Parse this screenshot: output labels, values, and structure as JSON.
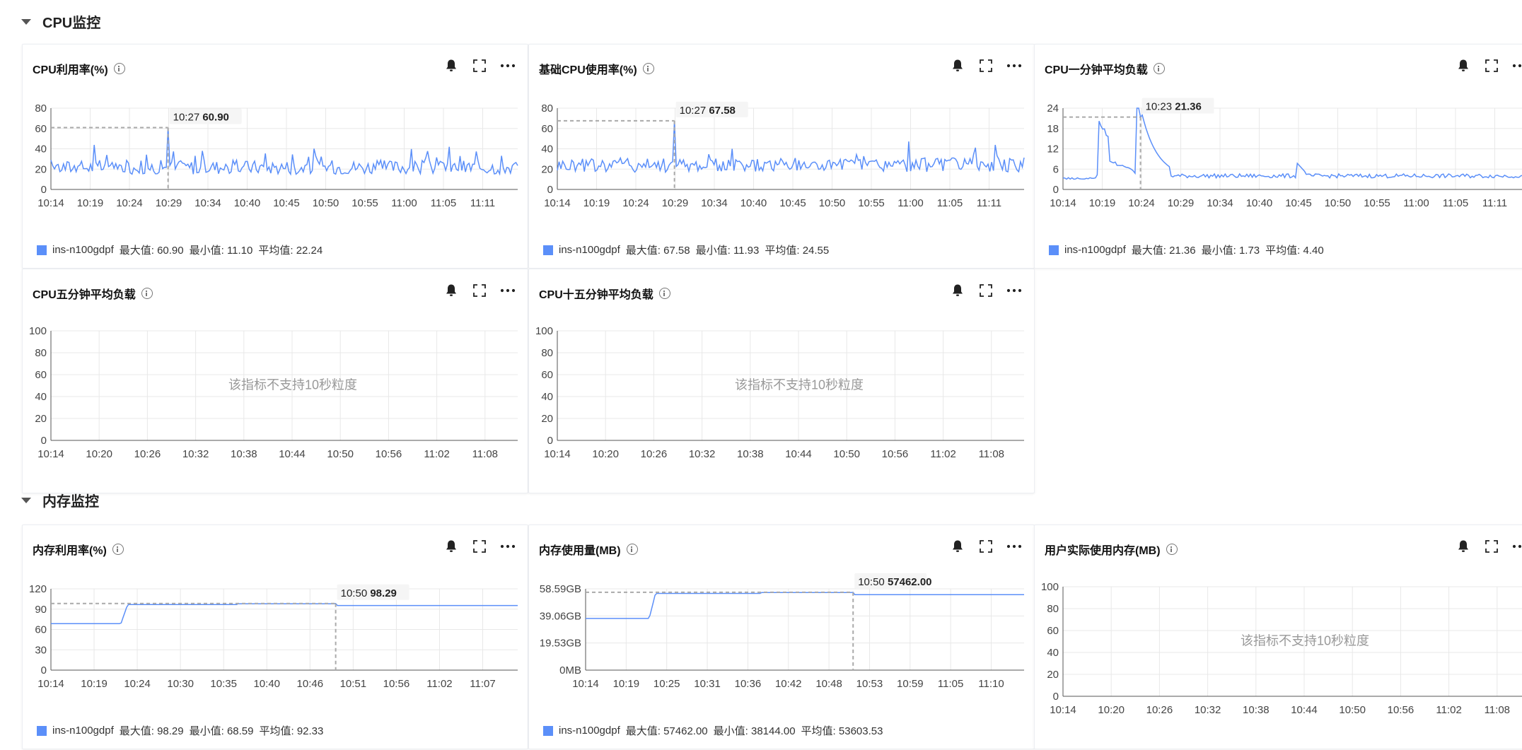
{
  "sections": {
    "cpu": "CPU监控",
    "mem": "内存监控"
  },
  "cards": [
    {
      "title": "CPU利用率(%)",
      "yticks": [
        "80",
        "60",
        "40",
        "20",
        "0"
      ],
      "ymax": 80,
      "xticks": [
        "10:14",
        "10:19",
        "10:24",
        "10:29",
        "10:34",
        "10:40",
        "10:45",
        "10:50",
        "10:55",
        "11:00",
        "11:05",
        "11:11"
      ],
      "tooltip": {
        "time": "10:27",
        "value": "60.90"
      },
      "legend": {
        "name": "ins-n100gdpf",
        "max": "最大值: 60.90",
        "min": "最小值: 11.10",
        "avg": "平均值: 22.24"
      },
      "series_shape": "spiky",
      "peak_fraction": 0.25,
      "peak_value": 60.9,
      "base_value": 22
    },
    {
      "title": "基础CPU使用率(%)",
      "yticks": [
        "80",
        "60",
        "40",
        "20",
        "0"
      ],
      "ymax": 80,
      "xticks": [
        "10:14",
        "10:19",
        "10:24",
        "10:29",
        "10:34",
        "10:40",
        "10:45",
        "10:50",
        "10:55",
        "11:00",
        "11:05",
        "11:11"
      ],
      "tooltip": {
        "time": "10:27",
        "value": "67.58"
      },
      "legend": {
        "name": "ins-n100gdpf",
        "max": "最大值: 67.58",
        "min": "最小值: 11.93",
        "avg": "平均值: 24.55"
      },
      "series_shape": "spiky",
      "peak_fraction": 0.25,
      "peak_value": 67.58,
      "base_value": 24
    },
    {
      "title": "CPU一分钟平均负载",
      "yticks": [
        "24",
        "18",
        "12",
        "6",
        "0"
      ],
      "ymax": 24,
      "xticks": [
        "10:14",
        "10:19",
        "10:24",
        "10:29",
        "10:34",
        "10:40",
        "10:45",
        "10:50",
        "10:55",
        "11:00",
        "11:05",
        "11:11"
      ],
      "tooltip": {
        "time": "10:23",
        "value": "21.36"
      },
      "legend": {
        "name": "ins-n100gdpf",
        "max": "最大值: 21.36",
        "min": "最小值: 1.73",
        "avg": "平均值: 4.40"
      },
      "series_shape": "load",
      "peak_fraction": 0.165,
      "peak_value": 21.36,
      "base_value": 4
    },
    {
      "title": "CPU五分钟平均负载",
      "yticks": [
        "100",
        "80",
        "60",
        "40",
        "20",
        "0"
      ],
      "ymax": 100,
      "xticks": [
        "10:14",
        "10:20",
        "10:26",
        "10:32",
        "10:38",
        "10:44",
        "10:50",
        "10:56",
        "11:02",
        "11:08"
      ],
      "empty_text": "该指标不支持10秒粒度"
    },
    {
      "title": "CPU十五分钟平均负载",
      "yticks": [
        "100",
        "80",
        "60",
        "40",
        "20",
        "0"
      ],
      "ymax": 100,
      "xticks": [
        "10:14",
        "10:20",
        "10:26",
        "10:32",
        "10:38",
        "10:44",
        "10:50",
        "10:56",
        "11:02",
        "11:08"
      ],
      "empty_text": "该指标不支持10秒粒度"
    },
    {
      "title": "内存利用率(%)",
      "yticks": [
        "120",
        "90",
        "60",
        "30",
        "0"
      ],
      "ymax": 120,
      "xticks": [
        "10:14",
        "10:19",
        "10:24",
        "10:30",
        "10:35",
        "10:40",
        "10:46",
        "10:51",
        "10:56",
        "11:02",
        "11:07"
      ],
      "tooltip": {
        "time": "10:50",
        "value": "98.29"
      },
      "legend": {
        "name": "ins-n100gdpf",
        "max": "最大值: 98.29",
        "min": "最小值: 68.59",
        "avg": "平均值: 92.33"
      },
      "series_shape": "step",
      "peak_fraction": 0.61,
      "peak_value": 98.29,
      "base_value": 68.59,
      "step_fraction": 0.15
    },
    {
      "title": "内存使用量(MB)",
      "yticks": [
        "58.59GB",
        "39.06GB",
        "19.53GB",
        "0MB"
      ],
      "ymax": 60000,
      "xticks": [
        "10:14",
        "10:19",
        "10:25",
        "10:31",
        "10:36",
        "10:42",
        "10:48",
        "10:53",
        "10:59",
        "11:05",
        "11:10"
      ],
      "tooltip": {
        "time": "10:50",
        "value": "57462.00"
      },
      "legend": {
        "name": "ins-n100gdpf",
        "max": "最大值: 57462.00",
        "min": "最小值: 38144.00",
        "avg": "平均值: 53603.53"
      },
      "series_shape": "step",
      "peak_fraction": 0.61,
      "peak_value": 57462,
      "base_value": 38144,
      "step_fraction": 0.145
    },
    {
      "title": "用户实际使用内存(MB)",
      "yticks": [
        "100",
        "80",
        "60",
        "40",
        "20",
        "0"
      ],
      "ymax": 100,
      "xticks": [
        "10:14",
        "10:20",
        "10:26",
        "10:32",
        "10:38",
        "10:44",
        "10:50",
        "10:56",
        "11:02",
        "11:08"
      ],
      "empty_text": "该指标不支持10秒粒度"
    }
  ],
  "colors": {
    "line": "#5b8ff9",
    "grid": "#e8e8e8",
    "axis": "#555",
    "dash": "#aaa"
  }
}
